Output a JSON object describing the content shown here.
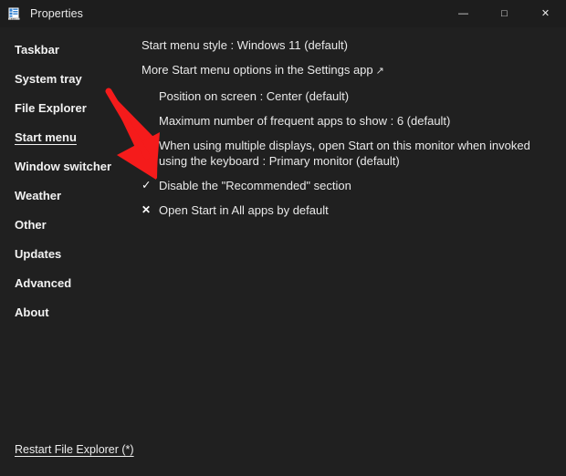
{
  "window": {
    "title": "Properties",
    "icon": "properties-window-icon",
    "controls": {
      "minimize": "—",
      "maximize": "□",
      "close": "✕"
    }
  },
  "sidebar": {
    "items": [
      {
        "label": "Taskbar",
        "selected": false
      },
      {
        "label": "System tray",
        "selected": false
      },
      {
        "label": "File Explorer",
        "selected": false
      },
      {
        "label": "Start menu",
        "selected": true
      },
      {
        "label": "Window switcher",
        "selected": false
      },
      {
        "label": "Weather",
        "selected": false
      },
      {
        "label": "Other",
        "selected": false
      },
      {
        "label": "Updates",
        "selected": false
      },
      {
        "label": "Advanced",
        "selected": false
      },
      {
        "label": "About",
        "selected": false
      }
    ]
  },
  "main": {
    "options": [
      {
        "text": "Start menu style : Windows 11 (default)",
        "level": 0,
        "glyph": "",
        "external_link": false
      },
      {
        "text": "More Start menu options in the Settings app",
        "level": 0,
        "glyph": "",
        "external_link": true,
        "external_arrow": "↗"
      },
      {
        "text": "Position on screen : Center (default)",
        "level": 1,
        "glyph": "",
        "external_link": false
      },
      {
        "text": "Maximum number of frequent apps to show : 6 (default)",
        "level": 1,
        "glyph": "",
        "external_link": false
      },
      {
        "text": "When using multiple displays, open Start on this monitor when invoked using the keyboard : Primary monitor (default)",
        "level": 1,
        "glyph": "",
        "external_link": false
      },
      {
        "text": "Disable the \"Recommended\" section",
        "level": 1,
        "glyph": "✓",
        "glyph_name": "checkmark-icon",
        "external_link": false
      },
      {
        "text": "Open Start in All apps by default",
        "level": 1,
        "glyph": "✕",
        "glyph_name": "cross-icon",
        "external_link": false
      }
    ]
  },
  "footer": {
    "restart_link": "Restart File Explorer (*)"
  },
  "annotation": {
    "type": "arrow",
    "color": "#f51b1b",
    "points_to": "Disable the \"Recommended\" section"
  },
  "colors": {
    "window_background": "#202020",
    "titlebar_background": "#1d1d1d",
    "text": "#e9e9e9",
    "accent_red": "#f51b1b",
    "close_hover": "#c42b1c"
  }
}
